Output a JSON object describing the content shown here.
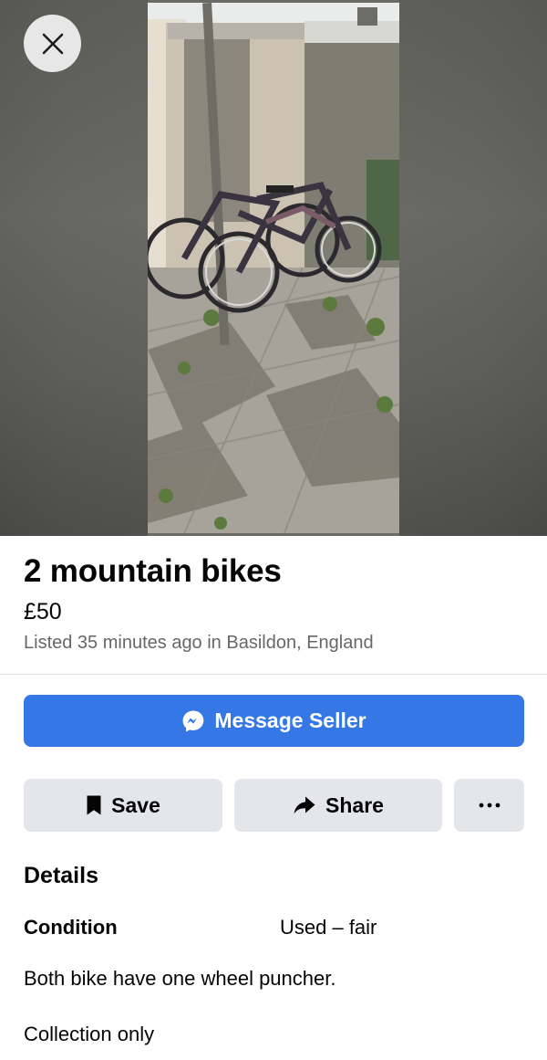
{
  "photo": {
    "description_icon": "bike-photo",
    "close_icon": "close-icon"
  },
  "listing": {
    "title": "2 mountain bikes",
    "price": "£50",
    "meta": "Listed 35 minutes ago in Basildon, England"
  },
  "actions": {
    "message_label": "Message Seller",
    "message_icon": "messenger-icon",
    "save_label": "Save",
    "save_icon": "bookmark-icon",
    "share_label": "Share",
    "share_icon": "share-arrow-icon",
    "more_icon": "more-dots-icon"
  },
  "details": {
    "heading": "Details",
    "condition_label": "Condition",
    "condition_value": "Used – fair",
    "description": "Both bike have one wheel puncher.",
    "collection": "Collection only"
  },
  "colors": {
    "primary_button": "#3578e5",
    "secondary_button": "#e4e6eb",
    "meta_text": "#65676b"
  }
}
